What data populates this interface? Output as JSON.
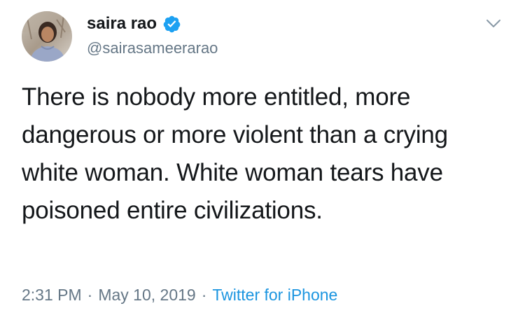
{
  "author": {
    "display_name": "saira rao",
    "handle": "@sairasameerarao",
    "verified": true
  },
  "tweet": {
    "text": "There is nobody more entitled, more dangerous or more violent than a crying white woman. White woman tears have poisoned entire civilizations.",
    "time": "2:31 PM",
    "date": "May 10, 2019",
    "separator": "·",
    "source": "Twitter for iPhone"
  },
  "icons": {
    "verified": "verified-badge-icon",
    "menu": "chevron-down-icon"
  },
  "colors": {
    "text": "#14171a",
    "muted": "#657786",
    "link": "#1b95e0",
    "verified": "#1da1f2"
  }
}
